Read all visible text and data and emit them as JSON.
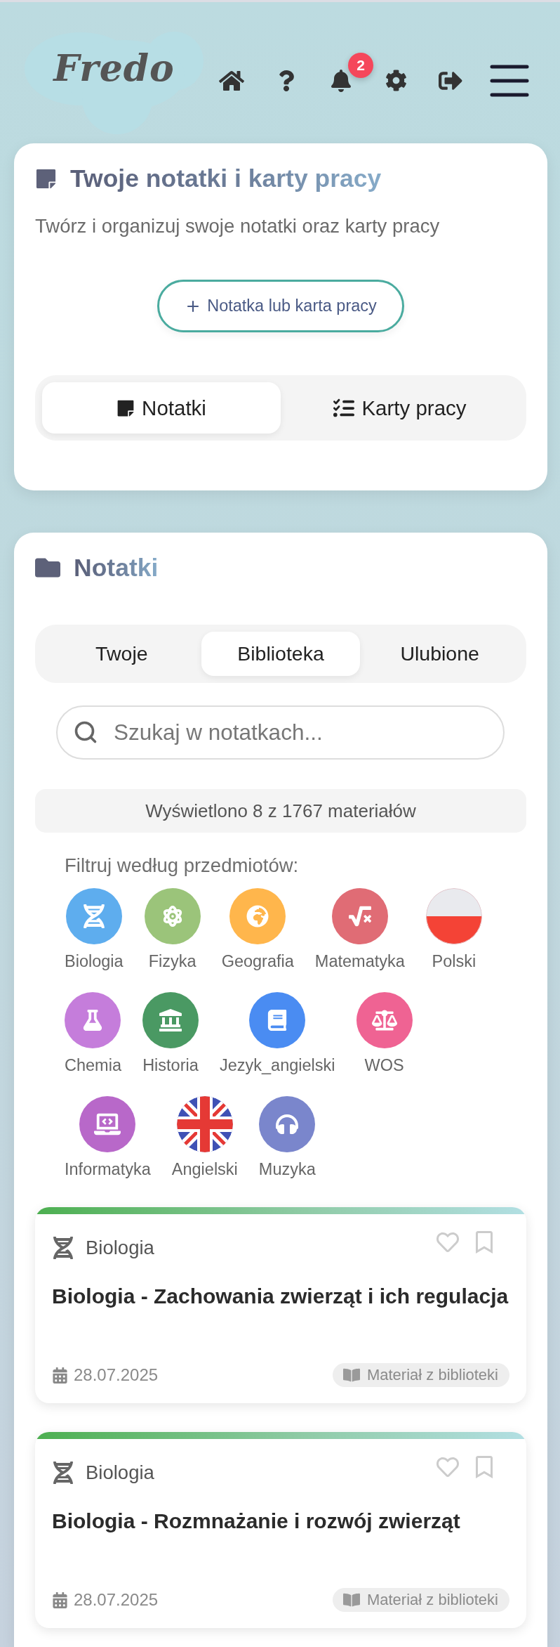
{
  "header": {
    "logo": "Fredo",
    "notification_badge": "2"
  },
  "intro": {
    "title": "Twoje notatki i karty pracy",
    "subtitle": "Twórz i organizuj swoje notatki oraz karty pracy",
    "create_button": "Notatka lub karta pracy",
    "view_tabs": [
      {
        "label": "Notatki",
        "kind": "notes",
        "selected": true
      },
      {
        "label": "Karty pracy",
        "kind": "worksheets",
        "selected": false
      }
    ]
  },
  "notes_panel": {
    "title": "Notatki",
    "source_tabs": [
      {
        "label": "Twoje",
        "selected": false
      },
      {
        "label": "Biblioteka",
        "selected": true
      },
      {
        "label": "Ulubione",
        "selected": false
      }
    ],
    "search": {
      "placeholder": "Szukaj w notatkach..."
    },
    "results_info": "Wyświetlono 8 z 1767 materiałów",
    "filter_label": "Filtruj według przedmiotów:",
    "subjects": [
      {
        "label": "Biologia",
        "kind": "dna",
        "color": "#5eadee"
      },
      {
        "label": "Fizyka",
        "kind": "atom",
        "color": "#9bc47a"
      },
      {
        "label": "Geografia",
        "kind": "globe",
        "color": "#ffb64c"
      },
      {
        "label": "Matematyka",
        "kind": "sqrt",
        "color": "#e06c75"
      },
      {
        "label": "Polski",
        "kind": "poland"
      },
      {
        "label": "Chemia",
        "kind": "flask",
        "color": "#c57ddb"
      },
      {
        "label": "Historia",
        "kind": "landmark",
        "color": "#4a9963"
      },
      {
        "label": "Jezyk_angielski",
        "kind": "book",
        "color": "#4a8cf2"
      },
      {
        "label": "WOS",
        "kind": "scale",
        "color": "#ef6393"
      },
      {
        "label": "Informatyka",
        "kind": "laptop",
        "color": "#b868c9"
      },
      {
        "label": "Angielski",
        "kind": "britain"
      },
      {
        "label": "Muzyka",
        "kind": "headphones",
        "color": "#7a86cc"
      }
    ],
    "notes": [
      {
        "subject": {
          "label": "Biologia",
          "kind": "dna"
        },
        "favorite": false,
        "bookmarked": false,
        "title": "Biologia - Zachowania zwierząt i ich regulacja",
        "date": "28.07.2025",
        "badge": "Materiał z biblioteki"
      },
      {
        "subject": {
          "label": "Biologia",
          "kind": "dna"
        },
        "favorite": false,
        "bookmarked": false,
        "title": "Biologia - Rozmnażanie i rozwój zwierząt",
        "date": "28.07.2025",
        "badge": "Materiał z biblioteki"
      }
    ]
  }
}
